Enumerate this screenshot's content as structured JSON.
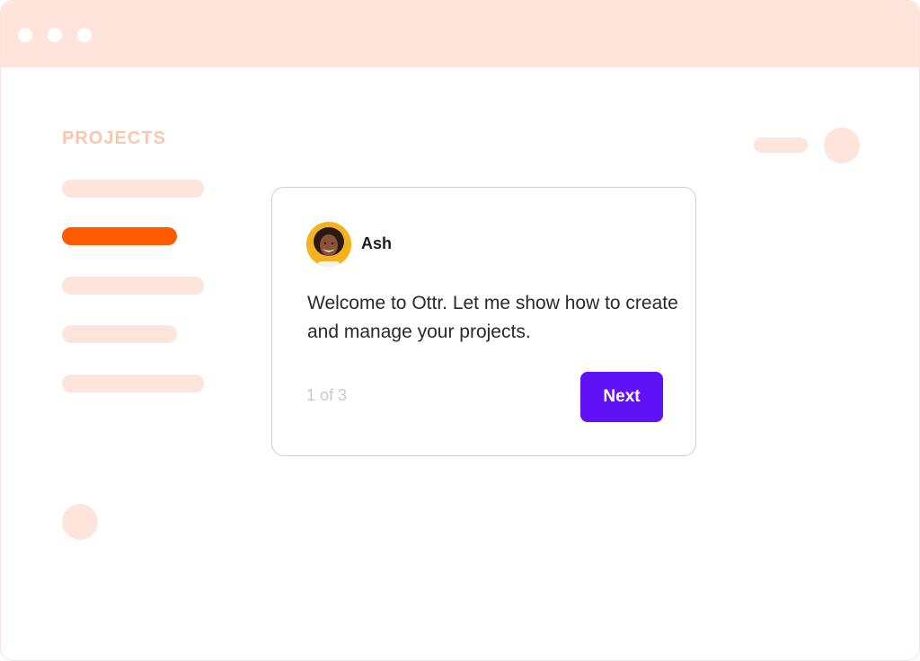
{
  "window": {
    "controls": [
      "dot",
      "dot",
      "dot"
    ]
  },
  "sidebar": {
    "title": "PROJECTS",
    "active_index": 1
  },
  "tour": {
    "author": {
      "name": "Ash",
      "avatar_icon": "person-avatar-icon"
    },
    "message": "Welcome to Ottr. Let me show how to create and manage your projects.",
    "step_text": "1 of 3",
    "next_label": "Next"
  },
  "colors": {
    "accent": "#ff5a00",
    "primary_button": "#6111f5",
    "placeholder": "#fde5dc",
    "label": "#f9c7ae",
    "avatar_bg": "#f3b321"
  }
}
